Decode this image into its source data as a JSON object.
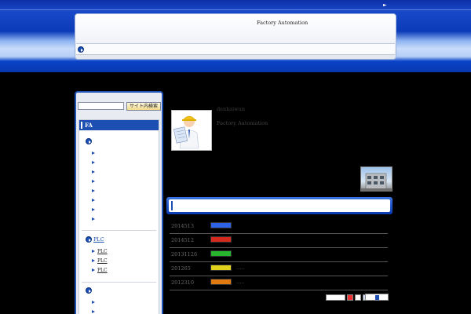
{
  "header": {
    "site_title": "Factory Automation",
    "top_arrow": "►"
  },
  "sidebar": {
    "search_placeholder": "",
    "search_button": "サイト内検索",
    "section_title": "FA",
    "plc_category": "PLC",
    "plc_items": [
      "PLC",
      "PLC",
      "PLC"
    ]
  },
  "profile": {
    "name": "denkaiwun",
    "description": "Factory Automation"
  },
  "news": {
    "items": [
      {
        "date": "2014513",
        "badge_color": "#2f63e6",
        "text": ""
      },
      {
        "date": "2014512",
        "badge_color": "#d42a1e",
        "text": ""
      },
      {
        "date": "20131126",
        "badge_color": "#27b530",
        "text": ""
      },
      {
        "date": "201265",
        "badge_color": "#e0d21c",
        "text": "……"
      },
      {
        "date": "2012310",
        "badge_color": "#e07a10",
        "text": "……"
      }
    ]
  },
  "colors": {
    "brand_blue": "#1d4fb2",
    "background": "#000000"
  },
  "icons": {
    "nav_bullet": "circle-arrow-icon",
    "list_bullet": "triangle-right-icon"
  }
}
